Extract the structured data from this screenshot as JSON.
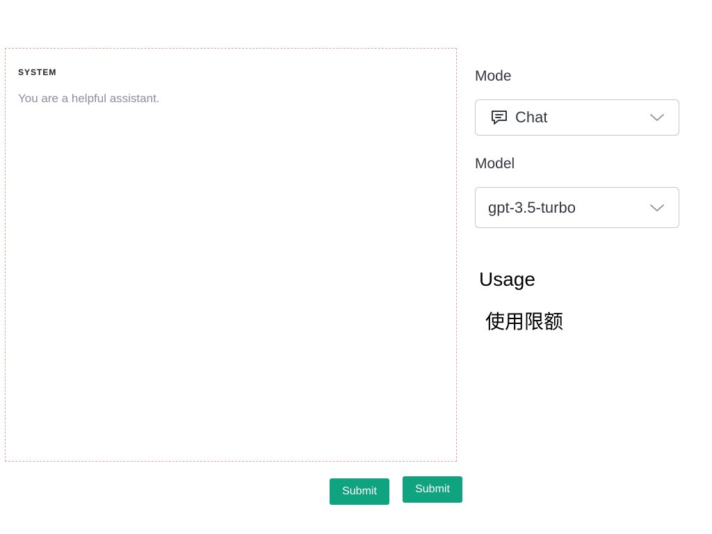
{
  "system": {
    "label": "SYSTEM",
    "placeholder": "You are a helpful assistant."
  },
  "buttons": {
    "submit_primary": "Submit",
    "submit_secondary": "Submit"
  },
  "mode": {
    "label": "Mode",
    "selected": "Chat",
    "icon": "chat-icon"
  },
  "model": {
    "label": "Model",
    "selected": "gpt-3.5-turbo"
  },
  "usage": {
    "title": "Usage",
    "limit_label": "使用限额"
  },
  "colors": {
    "accent": "#10a37f",
    "panel_border": "#e3a1a8",
    "select_border": "#c5c5d2",
    "text": "#353740",
    "placeholder": "#8e8ea0"
  }
}
